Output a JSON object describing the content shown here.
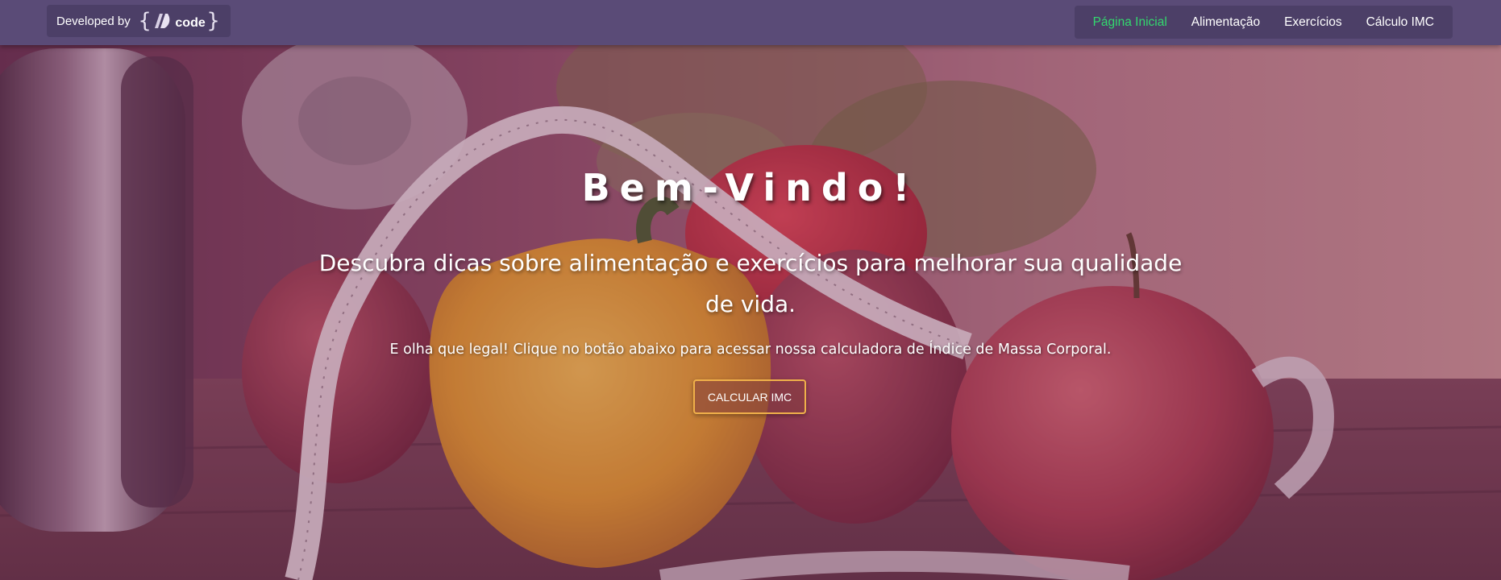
{
  "navbar": {
    "brand": {
      "developed_by": "Developed by",
      "logo_open_brace": "{",
      "logo_word": "code",
      "logo_close_brace": "}"
    },
    "links": [
      {
        "label": "Página Inicial",
        "active": true
      },
      {
        "label": "Alimentação",
        "active": false
      },
      {
        "label": "Exercícios",
        "active": false
      },
      {
        "label": "Cálculo IMC",
        "active": false
      }
    ]
  },
  "hero": {
    "title": "Bem-Vindo!",
    "subtitle": "Descubra dicas sobre alimentação e exercícios para melhorar sua qualidade de vida.",
    "lead": "E olha que legal! Clique no botão abaixo para acessar nossa calculadora de Índice de Massa Corporal.",
    "cta_label": "CALCULAR IMC"
  },
  "colors": {
    "navbar_bg": "#5a4b77",
    "nav_active": "#33d86e",
    "cta_border": "#f0b04a"
  },
  "icons": {
    "logo": "code-logo-icon"
  }
}
